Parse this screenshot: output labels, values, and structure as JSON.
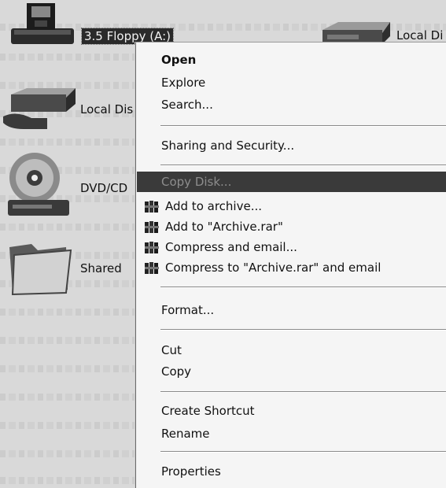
{
  "desktop": {
    "icons": [
      {
        "label": "3.5 Floppy (A:)"
      },
      {
        "label": "Local Di"
      },
      {
        "label": "Local Dis"
      },
      {
        "label": "DVD/CD"
      },
      {
        "label": "Shared"
      }
    ]
  },
  "context_menu": {
    "items": [
      {
        "label": "Open"
      },
      {
        "label": "Explore"
      },
      {
        "label": "Search..."
      },
      {
        "label": "Sharing and Security..."
      },
      {
        "label": "Copy Disk..."
      },
      {
        "label": "Add to archive..."
      },
      {
        "label": "Add to \"Archive.rar\""
      },
      {
        "label": "Compress and email..."
      },
      {
        "label": "Compress to \"Archive.rar\" and email"
      },
      {
        "label": "Format..."
      },
      {
        "label": "Cut"
      },
      {
        "label": "Copy"
      },
      {
        "label": "Create Shortcut"
      },
      {
        "label": "Rename"
      },
      {
        "label": "Properties"
      }
    ],
    "highlighted_item": "Copy Disk...",
    "colors": {
      "highlight": "#3a3a3a",
      "highlight_text": "#8d8d8d",
      "menu_bg": "#f5f5f5"
    }
  }
}
